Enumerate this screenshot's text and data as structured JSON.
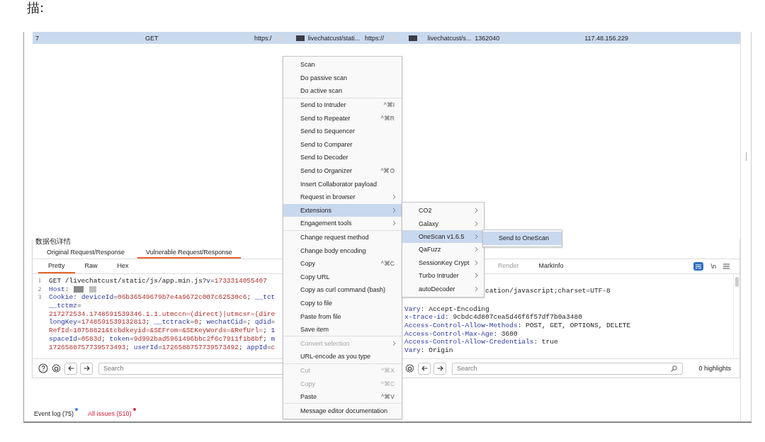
{
  "article_text": "描:",
  "request_table": {
    "rows": [
      {
        "selected": true,
        "cells": [
          {
            "text": "7"
          },
          {
            "text": "GET"
          },
          {
            "text": "https:/",
            "redacted": true
          },
          {
            "text": "livechatcust/stati..."
          },
          {
            "text": "https://",
            "redacted": true
          },
          {
            "text": "livechatcust/s..."
          },
          {
            "text": "1362040"
          },
          {
            "text": "117.48.156.229"
          }
        ]
      }
    ]
  },
  "details": {
    "title": "数据包详情",
    "tabs": [
      {
        "label": "Original Request/Response",
        "selected": false
      },
      {
        "label": "Vulnerable Request/Response",
        "selected": true
      }
    ],
    "request_editor": {
      "tabs": [
        {
          "label": "Pretty",
          "selected": true,
          "disabled": false
        },
        {
          "label": "Raw",
          "selected": false,
          "disabled": false
        },
        {
          "label": "Hex",
          "selected": false,
          "disabled": false
        }
      ],
      "lines": [
        {
          "number": "1",
          "segments": [
            {
              "kind": "plain",
              "text": "GET /livechatcust/static/js/app.min.js?"
            },
            {
              "kind": "key",
              "text": "v"
            },
            {
              "kind": "plain",
              "text": "="
            },
            {
              "kind": "value",
              "text": "1733314055407"
            }
          ]
        },
        {
          "number": "2",
          "segments": [
            {
              "kind": "key",
              "text": "Host"
            },
            {
              "kind": "plain",
              "text": ":"
            },
            {
              "kind": "redacted"
            },
            {
              "kind": "redacted"
            }
          ]
        },
        {
          "number": "3",
          "segments": [
            {
              "kind": "key",
              "text": "Cookie"
            },
            {
              "kind": "plain",
              "text": ": "
            },
            {
              "kind": "key",
              "text": "deviceId"
            },
            {
              "kind": "plain",
              "text": "="
            },
            {
              "kind": "value",
              "text": "06b36549679b7e4a9672c007c62530c6"
            },
            {
              "kind": "plain",
              "text": "; "
            },
            {
              "kind": "key",
              "text": "__tct"
            }
          ]
        },
        {
          "segments": [
            {
              "kind": "key",
              "text": "__tctmz"
            },
            {
              "kind": "plain",
              "text": "="
            }
          ]
        },
        {
          "segments": [
            {
              "kind": "value",
              "text": "217272534.1748591539346.1.1.utmccn=(direct)|utmcsr=(dire"
            }
          ]
        },
        {
          "segments": [
            {
              "kind": "key",
              "text": "longKey"
            },
            {
              "kind": "plain",
              "text": "="
            },
            {
              "kind": "value",
              "text": "1748591539132813"
            },
            {
              "kind": "plain",
              "text": "; "
            },
            {
              "kind": "key",
              "text": "__tctrack"
            },
            {
              "kind": "plain",
              "text": "="
            },
            {
              "kind": "value",
              "text": "0"
            },
            {
              "kind": "plain",
              "text": "; "
            },
            {
              "kind": "key",
              "text": "wechatCid"
            },
            {
              "kind": "plain",
              "text": "=; "
            },
            {
              "kind": "key",
              "text": "qdid"
            },
            {
              "kind": "plain",
              "text": "="
            }
          ]
        },
        {
          "segments": [
            {
              "kind": "value",
              "text": "RefId=10758821&tcbdkeyid=&SEFrom=&SEKeyWords=&RefUrl="
            },
            {
              "kind": "plain",
              "text": "; "
            },
            {
              "kind": "key",
              "text": "1"
            }
          ]
        },
        {
          "segments": [
            {
              "kind": "key",
              "text": "spaceId"
            },
            {
              "kind": "plain",
              "text": "="
            },
            {
              "kind": "value",
              "text": "0583d"
            },
            {
              "kind": "plain",
              "text": "; "
            },
            {
              "kind": "key",
              "text": "token"
            },
            {
              "kind": "plain",
              "text": "="
            },
            {
              "kind": "value",
              "text": "9d992bad5961496bbc2f6c7911f1b8bf"
            },
            {
              "kind": "plain",
              "text": "; "
            },
            {
              "kind": "key",
              "text": "m"
            }
          ]
        },
        {
          "segments": [
            {
              "kind": "value",
              "text": "1726588757739573493"
            },
            {
              "kind": "plain",
              "text": "; "
            },
            {
              "kind": "key",
              "text": "userId"
            },
            {
              "kind": "plain",
              "text": "="
            },
            {
              "kind": "value",
              "text": "1726588757739573492"
            },
            {
              "kind": "plain",
              "text": "; "
            },
            {
              "kind": "key",
              "text": "appId"
            },
            {
              "kind": "plain",
              "text": "="
            },
            {
              "kind": "value",
              "text": "c"
            }
          ]
        }
      ],
      "search": {
        "placeholder": "Search"
      }
    },
    "response_editor": {
      "tabs": [
        {
          "label": "Render",
          "selected": false,
          "disabled": true
        },
        {
          "label": "MarkInfo",
          "selected": false,
          "disabled": false
        }
      ],
      "wrap_toggle": {
        "on": true
      },
      "newline_toggle": "\\n",
      "lines": [
        {
          "kind": "partial",
          "segments": [
            {
              "kind": "plain",
              "text": "cation/javascript;charset=UTF-8"
            }
          ]
        },
        {
          "segments": [
            {
              "kind": "key",
              "text": "Vary"
            },
            {
              "kind": "plain",
              "text": ": Accept-Encoding"
            }
          ]
        },
        {
          "segments": [
            {
              "kind": "key",
              "text": "x-trace-id"
            },
            {
              "kind": "plain",
              "text": ": 9cbdc4d807cea5d46f6f57df7b0a3480"
            }
          ]
        },
        {
          "segments": [
            {
              "kind": "key",
              "text": "Access-Control-Allow-Methods"
            },
            {
              "kind": "plain",
              "text": ": POST, GET, OPTIONS, DELETE"
            }
          ]
        },
        {
          "segments": [
            {
              "kind": "key",
              "text": "Access-Control-Max-Age"
            },
            {
              "kind": "plain",
              "text": ": 3600"
            }
          ]
        },
        {
          "segments": [
            {
              "kind": "key",
              "text": "Access-Control-Allow-Credentials"
            },
            {
              "kind": "plain",
              "text": ": true"
            }
          ]
        },
        {
          "segments": [
            {
              "kind": "key",
              "text": "Vary"
            },
            {
              "kind": "plain",
              "text": ": Origin"
            }
          ]
        }
      ],
      "search": {
        "placeholder": "Search"
      },
      "highlights": "0 highlights"
    }
  },
  "status_bar": [
    {
      "label": "Event log (75)",
      "color": "#2f7fe0",
      "alert": false
    },
    {
      "label": "All issues (510)",
      "color": "#e0203a",
      "alert": true
    }
  ],
  "context_menu": {
    "groups": [
      [
        {
          "label": "Scan",
          "selected": false,
          "disabled": false,
          "submenu": false
        },
        {
          "label": "Do passive scan",
          "selected": false,
          "disabled": false,
          "submenu": false
        },
        {
          "label": "Do active scan",
          "selected": false,
          "disabled": false,
          "submenu": false
        }
      ],
      [
        {
          "label": "Send to Intruder",
          "shortcut": "^⌘I",
          "selected": false,
          "disabled": false,
          "submenu": false
        },
        {
          "label": "Send to Repeater",
          "shortcut": "^⌘R",
          "selected": false,
          "disabled": false,
          "submenu": false
        },
        {
          "label": "Send to Sequencer",
          "selected": false,
          "disabled": false,
          "submenu": false
        },
        {
          "label": "Send to Comparer",
          "selected": false,
          "disabled": false,
          "submenu": false
        },
        {
          "label": "Send to Decoder",
          "selected": false,
          "disabled": false,
          "submenu": false
        },
        {
          "label": "Send to Organizer",
          "shortcut": "^⌘O",
          "selected": false,
          "disabled": false,
          "submenu": false
        },
        {
          "label": "Insert Collaborator payload",
          "selected": false,
          "disabled": false,
          "submenu": false
        },
        {
          "label": "Request in browser",
          "selected": false,
          "disabled": false,
          "submenu": true
        },
        {
          "label": "Extensions",
          "selected": true,
          "disabled": false,
          "submenu": true
        },
        {
          "label": "Engagement tools",
          "selected": false,
          "disabled": false,
          "submenu": true
        }
      ],
      [
        {
          "label": "Change request method",
          "selected": false,
          "disabled": false,
          "submenu": false
        },
        {
          "label": "Change body encoding",
          "selected": false,
          "disabled": false,
          "submenu": false
        },
        {
          "label": "Copy",
          "shortcut": "^⌘C",
          "selected": false,
          "disabled": false,
          "submenu": false
        },
        {
          "label": "Copy URL",
          "selected": false,
          "disabled": false,
          "submenu": false
        },
        {
          "label": "Copy as curl command (bash)",
          "selected": false,
          "disabled": false,
          "submenu": false
        },
        {
          "label": "Copy to file",
          "selected": false,
          "disabled": false,
          "submenu": false
        },
        {
          "label": "Paste from file",
          "selected": false,
          "disabled": false,
          "submenu": false
        },
        {
          "label": "Save item",
          "selected": false,
          "disabled": false,
          "submenu": false
        }
      ],
      [
        {
          "label": "Convert selection",
          "selected": false,
          "disabled": true,
          "submenu": true
        },
        {
          "label": "URL-encode as you type",
          "selected": false,
          "disabled": false,
          "submenu": false
        }
      ],
      [
        {
          "label": "Cut",
          "shortcut": "^⌘X",
          "selected": false,
          "disabled": true,
          "submenu": false
        },
        {
          "label": "Copy",
          "shortcut": "^⌘C",
          "selected": false,
          "disabled": true,
          "submenu": false
        },
        {
          "label": "Paste",
          "shortcut": "^⌘V",
          "selected": false,
          "disabled": false,
          "submenu": false
        }
      ],
      [
        {
          "label": "Message editor documentation",
          "selected": false,
          "disabled": false,
          "submenu": false
        }
      ]
    ]
  },
  "extensions_submenu": {
    "groups": [
      [
        {
          "label": "CO2",
          "selected": false,
          "disabled": false,
          "submenu": true
        },
        {
          "label": "Galaxy",
          "selected": false,
          "disabled": false,
          "submenu": true
        },
        {
          "label": "OneScan v1.6.5",
          "selected": true,
          "disabled": false,
          "submenu": true
        },
        {
          "label": "QaFuzz",
          "selected": false,
          "disabled": false,
          "submenu": true
        },
        {
          "label": "SessionKey Crypt",
          "selected": false,
          "disabled": false,
          "submenu": true
        },
        {
          "label": "Turbo Intruder",
          "selected": false,
          "disabled": false,
          "submenu": true
        },
        {
          "label": "autoDecoder",
          "selected": false,
          "disabled": false,
          "submenu": true
        }
      ]
    ]
  },
  "onescan_submenu": {
    "groups": [
      [
        {
          "label": "Send to OneScan",
          "selected": true,
          "disabled": false,
          "submenu": false
        }
      ]
    ]
  }
}
